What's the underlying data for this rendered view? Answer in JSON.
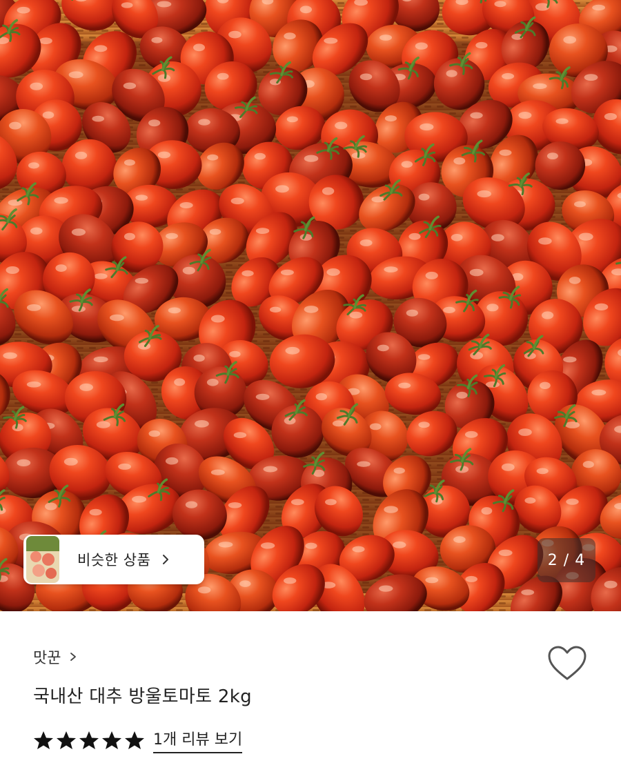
{
  "hero": {
    "similar_products_label": "비슷한 상품",
    "page_counter": "2 / 4"
  },
  "product": {
    "seller_name": "맛꾼",
    "title": "국내산 대추 방울토마토 2kg",
    "rating_stars": 5,
    "review_link_label": "1개 리뷰 보기"
  },
  "icons": {
    "similar_chevron": "chevron-right-icon",
    "seller_chevron": "chevron-right-icon",
    "wishlist": "heart-outline-icon",
    "star": "star-filled-icon"
  },
  "colors": {
    "star": "#111111",
    "heart_outline": "#555555",
    "counter_bg": "rgba(60,50,45,0.55)"
  }
}
